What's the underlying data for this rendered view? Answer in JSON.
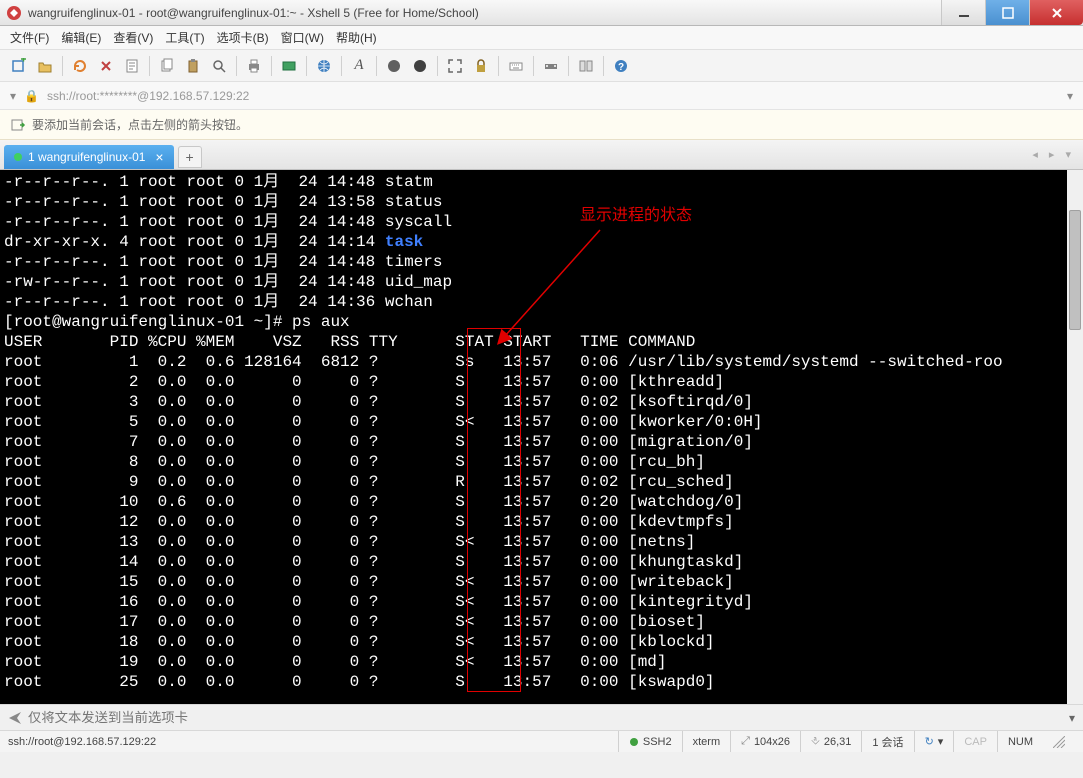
{
  "window": {
    "title": "wangruifenglinux-01 - root@wangruifenglinux-01:~ - Xshell 5 (Free for Home/School)"
  },
  "menu": {
    "file": "文件(F)",
    "edit": "编辑(E)",
    "view": "查看(V)",
    "tools": "工具(T)",
    "tabs": "选项卡(B)",
    "window": "窗口(W)",
    "help": "帮助(H)"
  },
  "address": {
    "url": "ssh://root:********@192.168.57.129:22"
  },
  "infobar": {
    "text": "要添加当前会话，点击左侧的箭头按钮。"
  },
  "tab": {
    "label": "1 wangruifenglinux-01"
  },
  "annotation": {
    "text": "显示进程的状态"
  },
  "terminal": {
    "ls_lines": [
      "-r--r--r--. 1 root root 0 1月  24 14:48 statm",
      "-r--r--r--. 1 root root 0 1月  24 13:58 status",
      "-r--r--r--. 1 root root 0 1月  24 14:48 syscall",
      "dr-xr-xr-x. 4 root root 0 1月  24 14:14 ",
      "-r--r--r--. 1 root root 0 1月  24 14:48 timers",
      "-rw-r--r--. 1 root root 0 1月  24 14:48 uid_map",
      "-r--r--r--. 1 root root 0 1月  24 14:36 wchan"
    ],
    "task_word": "task",
    "prompt": "[root@wangruifenglinux-01 ~]# ps aux",
    "header": "USER       PID %CPU %MEM    VSZ   RSS TTY      STAT START   TIME COMMAND",
    "rows": [
      "root         1  0.2  0.6 128164  6812 ?        Ss   13:57   0:06 /usr/lib/systemd/systemd --switched-roo",
      "root         2  0.0  0.0      0     0 ?        S    13:57   0:00 [kthreadd]",
      "root         3  0.0  0.0      0     0 ?        S    13:57   0:02 [ksoftirqd/0]",
      "root         5  0.0  0.0      0     0 ?        S<   13:57   0:00 [kworker/0:0H]",
      "root         7  0.0  0.0      0     0 ?        S    13:57   0:00 [migration/0]",
      "root         8  0.0  0.0      0     0 ?        S    13:57   0:00 [rcu_bh]",
      "root         9  0.0  0.0      0     0 ?        R    13:57   0:02 [rcu_sched]",
      "root        10  0.6  0.0      0     0 ?        S    13:57   0:20 [watchdog/0]",
      "root        12  0.0  0.0      0     0 ?        S    13:57   0:00 [kdevtmpfs]",
      "root        13  0.0  0.0      0     0 ?        S<   13:57   0:00 [netns]",
      "root        14  0.0  0.0      0     0 ?        S    13:57   0:00 [khungtaskd]",
      "root        15  0.0  0.0      0     0 ?        S<   13:57   0:00 [writeback]",
      "root        16  0.0  0.0      0     0 ?        S<   13:57   0:00 [kintegrityd]",
      "root        17  0.0  0.0      0     0 ?        S<   13:57   0:00 [bioset]",
      "root        18  0.0  0.0      0     0 ?        S<   13:57   0:00 [kblockd]",
      "root        19  0.0  0.0      0     0 ?        S<   13:57   0:00 [md]",
      "root        25  0.0  0.0      0     0 ?        S    13:57   0:00 [kswapd0]"
    ]
  },
  "sendbar": {
    "placeholder": "仅将文本发送到当前选项卡"
  },
  "status": {
    "left": "ssh://root@192.168.57.129:22",
    "ssh": "SSH2",
    "term": "xterm",
    "size": "104x26",
    "cursor": "26,31",
    "sessions": "1 会话",
    "cap": "CAP",
    "num": "NUM"
  }
}
